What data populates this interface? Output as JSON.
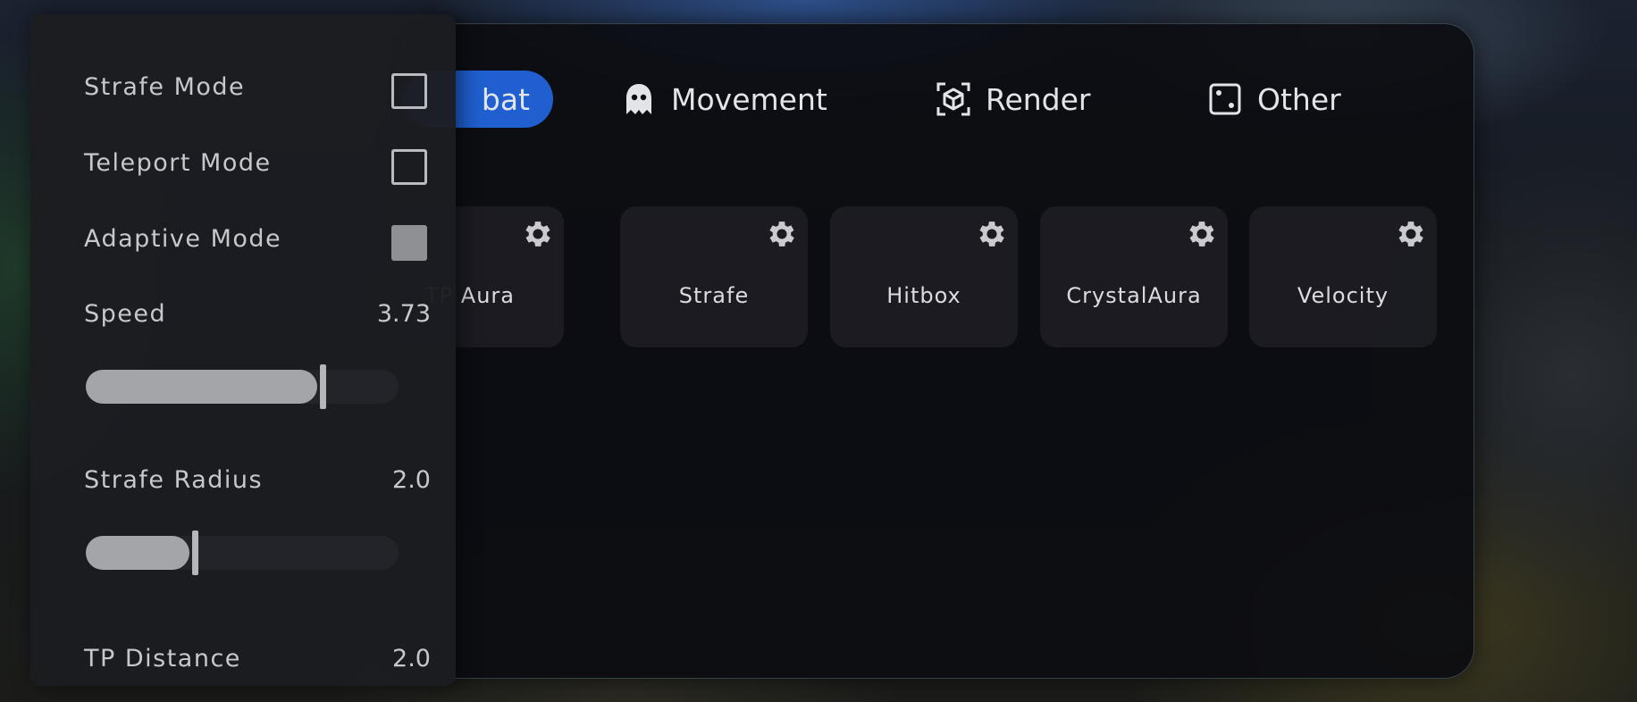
{
  "tabs": [
    {
      "label": "Combat",
      "icon": "sword-icon",
      "active": true
    },
    {
      "label": "Movement",
      "icon": "ghost-icon",
      "active": false
    },
    {
      "label": "Render",
      "icon": "cube-icon",
      "active": false
    },
    {
      "label": "Other",
      "icon": "dice-icon",
      "active": false
    }
  ],
  "visible_active_tab_text": "bat",
  "modules": [
    {
      "label": "TP Aura"
    },
    {
      "label": "Strafe"
    },
    {
      "label": "Hitbox"
    },
    {
      "label": "CrystalAura"
    },
    {
      "label": "Velocity"
    }
  ],
  "settings": {
    "strafe_mode": {
      "label": "Strafe Mode",
      "checked": false
    },
    "teleport_mode": {
      "label": "Teleport Mode",
      "checked": false
    },
    "adaptive_mode": {
      "label": "Adaptive Mode",
      "checked": true
    },
    "speed": {
      "label": "Speed",
      "value": "3.73",
      "fraction": 0.74
    },
    "strafe_radius": {
      "label": "Strafe Radius",
      "value": "2.0",
      "fraction": 0.33
    },
    "tp_distance": {
      "label": "TP Distance",
      "value": "2.0"
    }
  },
  "colors": {
    "accent": "#1f5fcf",
    "panel_bg": "#0c0d11",
    "settings_bg": "#1c1d21",
    "text": "#e2e4e8"
  }
}
